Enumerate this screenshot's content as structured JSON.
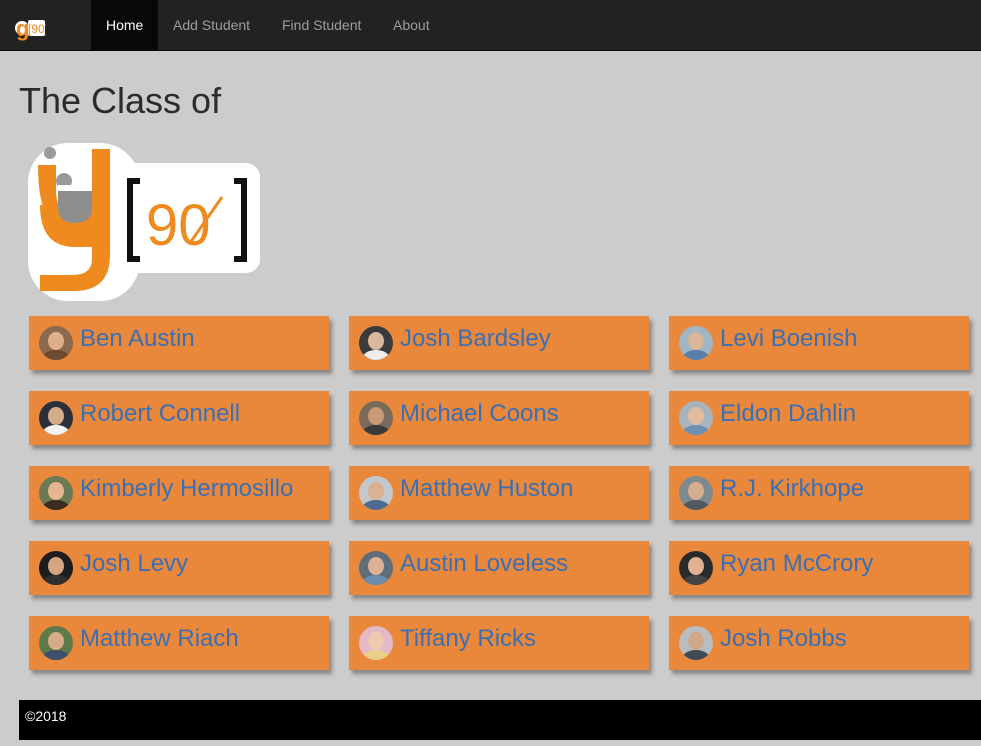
{
  "nav": {
    "brand_logo": "g90-logo",
    "items": [
      {
        "label": "Home",
        "active": true
      },
      {
        "label": "Add Student",
        "active": false
      },
      {
        "label": "Find Student",
        "active": false
      },
      {
        "label": "About",
        "active": false
      }
    ]
  },
  "main": {
    "title": "The Class of",
    "logo": "g90-logo"
  },
  "students": [
    {
      "name": "Ben Austin"
    },
    {
      "name": "Josh Bardsley"
    },
    {
      "name": "Levi Boenish"
    },
    {
      "name": "Robert Connell"
    },
    {
      "name": "Michael Coons"
    },
    {
      "name": "Eldon Dahlin"
    },
    {
      "name": "Kimberly Hermosillo"
    },
    {
      "name": "Matthew Huston"
    },
    {
      "name": "R.J. Kirkhope"
    },
    {
      "name": "Josh Levy"
    },
    {
      "name": "Austin Loveless"
    },
    {
      "name": "Ryan McCrory"
    },
    {
      "name": "Matthew Riach"
    },
    {
      "name": "Tiffany Ricks"
    },
    {
      "name": "Josh Robbs"
    }
  ],
  "footer": {
    "text": "©2018"
  },
  "colors": {
    "card": "#e9883a",
    "name": "#3a6fb5",
    "navbar": "#222222",
    "brand_orange": "#ef8a1f"
  }
}
